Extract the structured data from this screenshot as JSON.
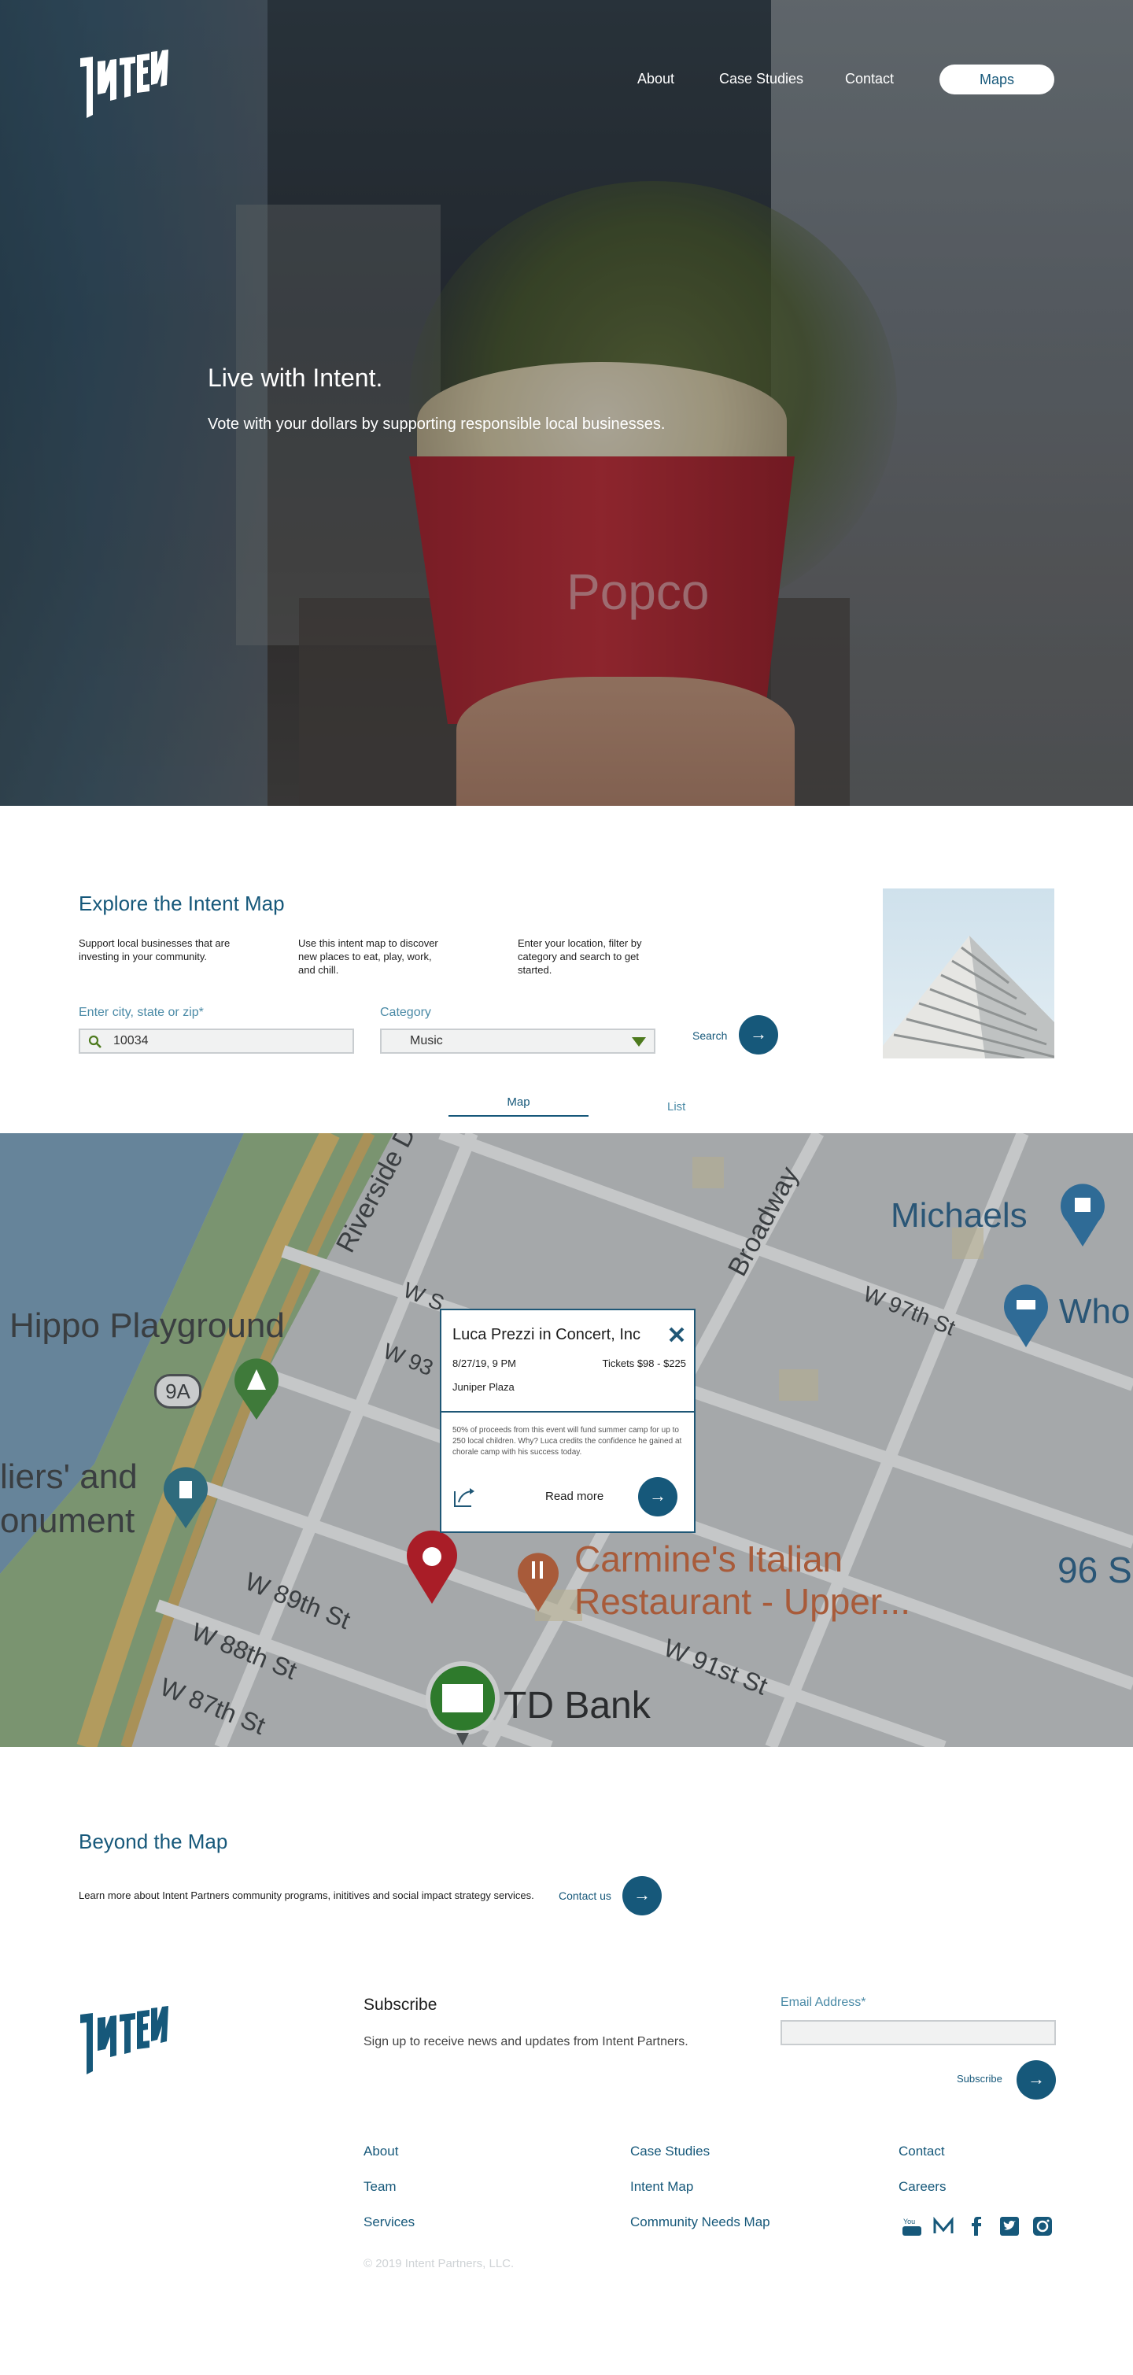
{
  "brand": {
    "name": "Intent"
  },
  "nav": {
    "about": "About",
    "case_studies": "Case Studies",
    "contact": "Contact",
    "maps": "Maps"
  },
  "hero": {
    "title": "Live with Intent.",
    "subtitle": "Vote with your dollars by supporting responsible local businesses.",
    "cup_text": "Popco"
  },
  "explore": {
    "title": "Explore the Intent Map",
    "col1": "Support local businesses that are investing in your community.",
    "col2": "Use this intent map to discover new places to eat, play, work, and chill.",
    "col3": "Enter your location, filter by category and search to get started.",
    "location_label": "Enter city, state or zip*",
    "location_value": "10034",
    "category_label": "Category",
    "category_value": "Music",
    "search_label": "Search",
    "tabs": [
      "Map",
      "List"
    ]
  },
  "map": {
    "labels": {
      "hippo": "Hippo Playground",
      "soldiers": "liers' and",
      "monument": "onument",
      "riverside": "Riverside Dr",
      "broadway": "Broadway",
      "michaels": "Michaels",
      "who": "Who",
      "w97": "W 97th St",
      "w93": "W 93",
      "ws": "W S",
      "route": "9A",
      "carmines1": "Carmine's Italian",
      "carmines2": "Restaurant - Upper...",
      "w89": "W 89th St",
      "w88": "W 88th St",
      "w87": "W 87th St",
      "w91": "W 91st St",
      "td": "TD Bank",
      "ninetysix": "96 S"
    },
    "popup": {
      "title": "Luca Prezzi in Concert, Inc",
      "datetime": "8/27/19, 9 PM",
      "tickets": "Tickets $98 - $225",
      "venue": "Juniper Plaza",
      "description": "50% of proceeds from this event will fund summer camp for up to 250 local children. Why? Luca credits the confidence he gained at chorale camp with his success today.",
      "read_more": "Read more"
    }
  },
  "beyond": {
    "title": "Beyond the Map",
    "text": "Learn more about Intent Partners community programs, inititives and social impact strategy services.",
    "contact": "Contact us"
  },
  "footer": {
    "subscribe_title": "Subscribe",
    "subscribe_text": "Sign up to receive news and updates from Intent Partners.",
    "email_label": "Email Address*",
    "subscribe_button": "Subscribe",
    "links": {
      "about": "About",
      "case_studies": "Case Studies",
      "contact": "Contact",
      "team": "Team",
      "intent_map": "Intent Map",
      "careers": "Careers",
      "services": "Services",
      "community": "Community Needs Map"
    },
    "copyright": "© 2019 Intent Partners, LLC.",
    "social": [
      "youtube-icon",
      "medium-icon",
      "facebook-icon",
      "twitter-icon",
      "instagram-icon"
    ]
  },
  "colors": {
    "brand": "#16587a",
    "accent_green": "#4d7a1e",
    "white": "#ffffff"
  }
}
